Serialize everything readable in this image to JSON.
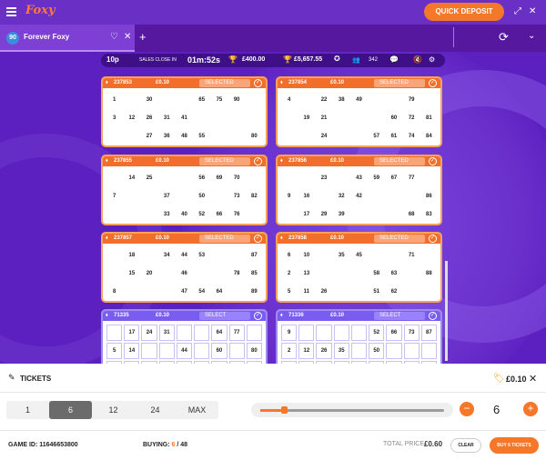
{
  "header": {
    "logo": "Foxy",
    "quick_deposit": "QUICK DEPOSIT",
    "expand_glyph": "⤢",
    "close_glyph": "✕"
  },
  "tab": {
    "badge": "90",
    "name": "Forever Foxy",
    "heart_glyph": "♡",
    "close_glyph": "✕",
    "add_glyph": "+",
    "refresh_glyph": "⟳",
    "chevron_glyph": "⌄"
  },
  "info": {
    "ticket_price": "10p",
    "sales_close_label": "SALES CLOSE IN",
    "timer": "01m:52s",
    "prize1": "£400.00",
    "prize2": "£5,657.55",
    "players": "342"
  },
  "cards": [
    {
      "id": "237853",
      "price": "£0.10",
      "status": "SELECTED",
      "style": "sel",
      "rows": [
        [
          "1",
          "",
          "30",
          "",
          "",
          "65",
          "75",
          "90",
          ""
        ],
        [
          "3",
          "12",
          "26",
          "31",
          "41",
          "",
          "",
          "",
          ""
        ],
        [
          "",
          "",
          "27",
          "36",
          "48",
          "55",
          "",
          "",
          "80"
        ]
      ]
    },
    {
      "id": "237854",
      "price": "£0.10",
      "status": "SELECTED",
      "style": "sel",
      "rows": [
        [
          "4",
          "",
          "22",
          "38",
          "49",
          "",
          "",
          "79",
          ""
        ],
        [
          "",
          "19",
          "21",
          "",
          "",
          "",
          "60",
          "72",
          "81"
        ],
        [
          "",
          "",
          "24",
          "",
          "",
          "57",
          "61",
          "74",
          "84"
        ]
      ]
    },
    {
      "id": "237855",
      "price": "£0.10",
      "status": "SELECTED",
      "style": "sel",
      "rows": [
        [
          "",
          "14",
          "25",
          "",
          "",
          "56",
          "69",
          "70",
          ""
        ],
        [
          "7",
          "",
          "",
          "37",
          "",
          "50",
          "",
          "73",
          "82"
        ],
        [
          "",
          "",
          "",
          "33",
          "40",
          "52",
          "66",
          "76",
          ""
        ]
      ]
    },
    {
      "id": "237856",
      "price": "£0.10",
      "status": "SELECTED",
      "style": "sel",
      "rows": [
        [
          "",
          "",
          "23",
          "",
          "43",
          "59",
          "67",
          "77",
          ""
        ],
        [
          "9",
          "16",
          "",
          "32",
          "42",
          "",
          "",
          "",
          "86"
        ],
        [
          "",
          "17",
          "29",
          "39",
          "",
          "",
          "",
          "68",
          "83"
        ]
      ]
    },
    {
      "id": "237857",
      "price": "£0.10",
      "status": "SELECTED",
      "style": "sel",
      "rows": [
        [
          "",
          "18",
          "",
          "34",
          "44",
          "53",
          "",
          "",
          "87"
        ],
        [
          "",
          "15",
          "20",
          "",
          "46",
          "",
          "",
          "78",
          "85"
        ],
        [
          "8",
          "",
          "",
          "",
          "47",
          "54",
          "64",
          "",
          "89"
        ]
      ]
    },
    {
      "id": "237858",
      "price": "£0.10",
      "status": "SELECTED",
      "style": "sel",
      "rows": [
        [
          "6",
          "10",
          "",
          "35",
          "45",
          "",
          "",
          "71",
          ""
        ],
        [
          "2",
          "13",
          "",
          "",
          "",
          "58",
          "63",
          "",
          "88"
        ],
        [
          "5",
          "11",
          "26",
          "",
          "",
          "51",
          "62",
          "",
          ""
        ]
      ]
    },
    {
      "id": "71335",
      "price": "£0.10",
      "status": "SELECT",
      "style": "blue",
      "rows": [
        [
          "",
          "17",
          "24",
          "31",
          "",
          "",
          "64",
          "77",
          ""
        ],
        [
          "5",
          "14",
          "",
          "",
          "44",
          "",
          "60",
          "",
          "80"
        ],
        [
          "",
          "",
          "",
          "",
          "",
          "",
          "",
          "",
          ""
        ]
      ]
    },
    {
      "id": "71336",
      "price": "£0.10",
      "status": "SELECT",
      "style": "blue",
      "rows": [
        [
          "9",
          "",
          "",
          "",
          "",
          "52",
          "66",
          "73",
          "87"
        ],
        [
          "2",
          "12",
          "26",
          "35",
          "",
          "50",
          "",
          "",
          ""
        ],
        [
          "",
          "",
          "",
          "",
          "",
          "",
          "",
          "",
          ""
        ]
      ]
    }
  ],
  "panel": {
    "title": "TICKETS",
    "price": "£0.10",
    "close_glyph": "✕",
    "options": [
      "1",
      "6",
      "12",
      "24",
      "MAX"
    ],
    "selected_option": "6",
    "quantity": "6",
    "slider_fraction": 0.13,
    "game_id_label": "GAME ID:",
    "game_id": "11646653800",
    "buying_label": "BUYING:",
    "buying_count": "6",
    "buying_total": "/ 48",
    "total_price_label": "TOTAL PRICE",
    "total_price": "£0.60",
    "clear_label": "CLEAR",
    "buy_label": "BUY 6 TICKETS"
  },
  "colors": {
    "accent": "#f4772a",
    "purple": "#5c1fc0",
    "selected_header": "#f26e2b",
    "unselected_header": "#7a5cf0"
  }
}
